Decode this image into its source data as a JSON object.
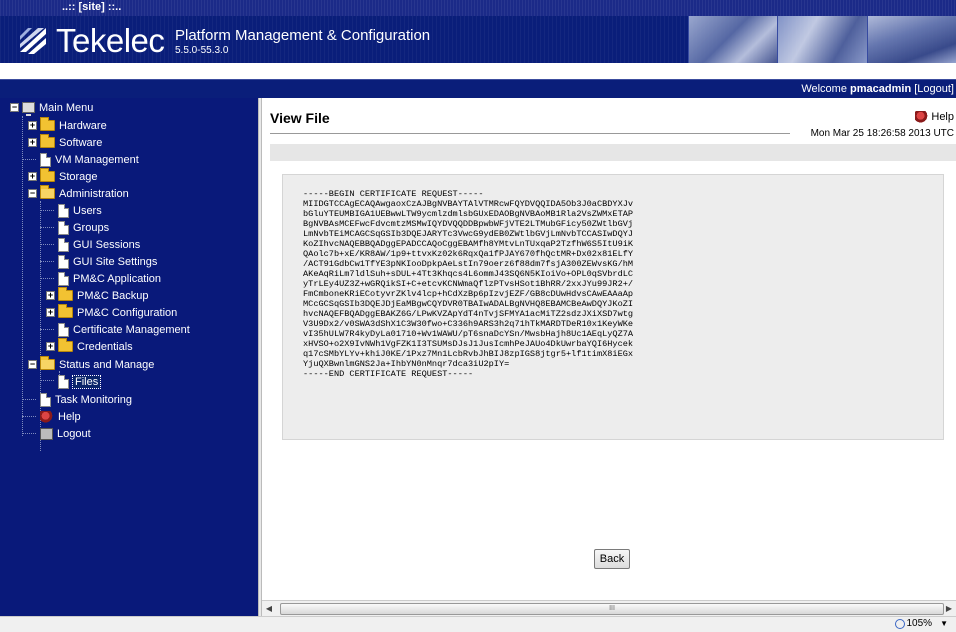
{
  "site_label": "..:: [site] ::..",
  "brand": {
    "name": "Tekelec",
    "app_title": "Platform Management & Configuration",
    "version": "5.5.0-55.3.0"
  },
  "welcome": {
    "prefix": "Welcome",
    "user": "pmacadmin",
    "logout": "[Logout]"
  },
  "menu": {
    "main": "Main Menu",
    "hardware": "Hardware",
    "software": "Software",
    "vm_management": "VM Management",
    "storage": "Storage",
    "administration": "Administration",
    "users": "Users",
    "groups": "Groups",
    "gui_sessions": "GUI Sessions",
    "gui_site_settings": "GUI Site Settings",
    "pmc_application": "PM&C Application",
    "pmc_backup": "PM&C Backup",
    "pmc_configuration": "PM&C Configuration",
    "certificate_management": "Certificate Management",
    "credentials": "Credentials",
    "status_and_manage": "Status and Manage",
    "files": "Files",
    "task_monitoring": "Task Monitoring",
    "help": "Help",
    "logout": "Logout"
  },
  "page": {
    "title": "View File",
    "help": "Help",
    "timestamp": "Mon Mar 25 18:26:58 2013 UTC",
    "file_content": "-----BEGIN CERTIFICATE REQUEST-----\nMIIDGTCCAgECAQAwgaoxCzAJBgNVBAYTAlVTMRcwFQYDVQQIDA5Ob3J0aCBDYXJv\nbGluYTEUMBIGA1UEBwwLTW9ycmlzdmlsbGUxEDAOBgNVBAoMB1Rla2VsZWMxETAP\nBgNVBAsMCEFwcFdvcmtzMSMwIQYDVQQDDBpwbWFjVTE2LTMubGFicy50ZWtlbGVj\nLmNvbTEiMCAGCSqGSIb3DQEJARYTc3VwcG9ydEB0ZWtlbGVjLmNvbTCCASIwDQYJ\nKoZIhvcNAQEBBQADggEPADCCAQoCggEBAMfh8YMtvLnTUxqaP2TzfhW6S5ItU9iK\nQAolc7b+xE/KR8AW/1p9+ttvxKz02k6RqxQa1fPJAY670fhQctMR+Dx02x81ELfY\n/ACT91GdbCw1TfYE3pNKIooDpkpAeLstIn79oerz6f88dm7fsjA300ZEWvsKG/hM\nAKeAqRiLm7ldlSuh+sDUL+4Tt3Khqcs4L6ommJ43SQ6N5KIoiVo+OPL0qSVbrdLC\nyTrLEy4UZ3Z+wGRQikSI+C+etcvKCNWmaQflzPTvsHSot1BhRR/2xxJYu99JR2+/\nFmCmboneKRiECotyvrZKlv4lcp+hCdXzBp6pIzvjEZF/GB8cDUwHdvsCAwEAAaAp\nMCcGCSqGSIb3DQEJDjEaMBgwCQYDVR0TBAIwADALBgNVHQ8EBAMCBeAwDQYJKoZI\nhvcNAQEFBQADggEBAKZ6G/LPwKVZApYdT4nTvjSFMYA1acMiTZ2sdzJXiXSD7wtg\nV3U9Dx2/v0SWA3dShX1C3W30fwo+C336h9ARS3h2q71hTkMARDTDeR10x1KeyWKe\nvI35hULW7R4kyDyLa01710+Wv1WAWU/pT6snaDcYSn/MwsbHajh8Uc1AEqLyQZ7A\nxHVSO+o2X9IvNWh1VgFZK1I3TSUMsDJsJ1JusIcmhPeJAUo4DkUwrbaYQI6Hycek\nq17cSMbYLYv+khiJ0KE/1Pxz7Mn1LcbRvbJhBIJ8zpIGS8jtgr5+lf1timX8iEGx\nYjuQXBwnlmGNS2Ja+IhbYN0nMnqr7dca3iU2pIY=\n-----END CERTIFICATE REQUEST-----",
    "back_button": "Back"
  },
  "scrollbar": {
    "thumb_grip": "III"
  },
  "status": {
    "zoom": "105%"
  },
  "colors": {
    "nav_bg": "#09197a",
    "banner_bg": "#0a1e7a",
    "content_bg": "#ffffff",
    "pre_bg": "#ededed"
  }
}
